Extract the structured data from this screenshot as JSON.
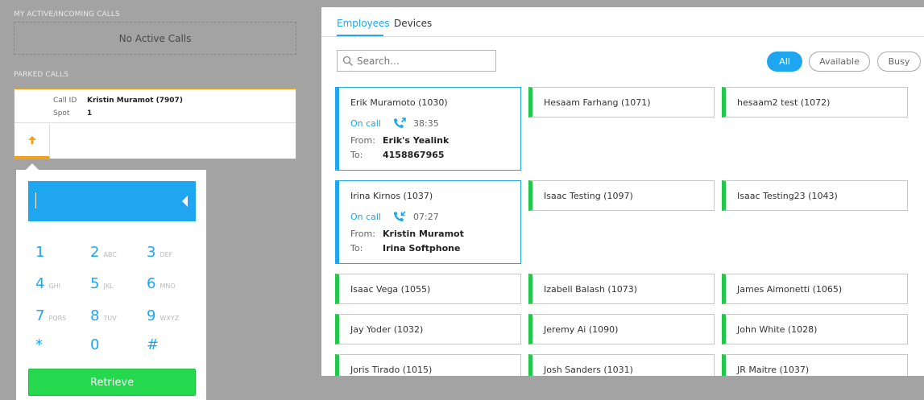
{
  "active_calls": {
    "label": "MY ACTIVE/INCOMING CALLS",
    "empty_text": "No Active Calls"
  },
  "parked_calls": {
    "label": "PARKED CALLS",
    "call_id_label": "Call ID",
    "call_id_value": "Kristin Muramot (7907)",
    "spot_label": "Spot",
    "spot_value": "1"
  },
  "dialer": {
    "keys": [
      {
        "digit": "1",
        "letters": ""
      },
      {
        "digit": "2",
        "letters": "ABC"
      },
      {
        "digit": "3",
        "letters": "DEF"
      },
      {
        "digit": "4",
        "letters": "GHI"
      },
      {
        "digit": "5",
        "letters": "JKL"
      },
      {
        "digit": "6",
        "letters": "MNO"
      },
      {
        "digit": "7",
        "letters": "PQRS"
      },
      {
        "digit": "8",
        "letters": "TUV"
      },
      {
        "digit": "9",
        "letters": "WXYZ"
      },
      {
        "digit": "*",
        "letters": ""
      },
      {
        "digit": "0",
        "letters": ""
      },
      {
        "digit": "#",
        "letters": ""
      }
    ],
    "retrieve_label": "Retrieve"
  },
  "tabs": [
    {
      "label": "Employees",
      "active": true
    },
    {
      "label": "Devices",
      "active": false
    }
  ],
  "search": {
    "placeholder": "Search..."
  },
  "filters": [
    {
      "label": "All",
      "selected": true
    },
    {
      "label": "Available",
      "selected": false
    },
    {
      "label": "Busy",
      "selected": false
    }
  ],
  "colors": {
    "accent": "#1ea6f0",
    "available": "#22c84a",
    "parked": "#f4a11a"
  },
  "employees": [
    {
      "name": "Erik Muramoto (1030)",
      "busy": true,
      "status": "On call",
      "duration": "38:35",
      "direction": "outgoing",
      "from_label": "From:",
      "from": "Erik's Yealink",
      "to_label": "To:",
      "to": "4158867965"
    },
    {
      "name": "Hesaam Farhang (1071)",
      "busy": false
    },
    {
      "name": "hesaam2 test (1072)",
      "busy": false
    },
    {
      "name": "Irina Kirnos (1037)",
      "busy": true,
      "status": "On call",
      "duration": "07:27",
      "direction": "incoming",
      "from_label": "From:",
      "from": "Kristin Muramot",
      "to_label": "To:",
      "to": "Irina Softphone"
    },
    {
      "name": "Isaac Testing (1097)",
      "busy": false
    },
    {
      "name": "Isaac Testing23 (1043)",
      "busy": false
    },
    {
      "name": "Isaac Vega (1055)",
      "busy": false
    },
    {
      "name": "Izabell Balash (1073)",
      "busy": false
    },
    {
      "name": "James Aimonetti (1065)",
      "busy": false
    },
    {
      "name": "Jay Yoder (1032)",
      "busy": false
    },
    {
      "name": "Jeremy Ai (1090)",
      "busy": false
    },
    {
      "name": "John White (1028)",
      "busy": false
    },
    {
      "name": "Joris Tirado (1015)",
      "busy": false
    },
    {
      "name": "Josh Sanders (1031)",
      "busy": false
    },
    {
      "name": "JR Maitre (1037)",
      "busy": false
    }
  ]
}
